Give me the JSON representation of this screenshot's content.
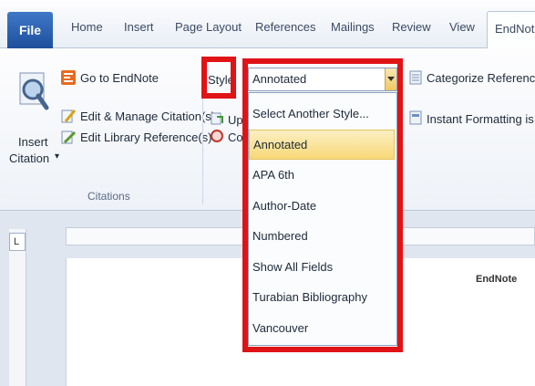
{
  "tabs": {
    "file": "File",
    "home": "Home",
    "insert": "Insert",
    "page_layout": "Page Layout",
    "references": "References",
    "mailings": "Mailings",
    "review": "Review",
    "view": "View",
    "endnote": "EndNote"
  },
  "citations_group": {
    "insert_citation_line1": "Insert",
    "insert_citation_line2": "Citation",
    "insert_citation_arrow": "▾",
    "go_to_endnote": "Go to EndNote",
    "edit_manage": "Edit & Manage Citation(s)",
    "edit_library": "Edit Library Reference(s)",
    "group_label": "Citations"
  },
  "bibliography_group": {
    "style_label": "Style",
    "update_partial": "Upd",
    "convert_partial": "Cor",
    "style_selected": "Annotated",
    "categorize": "Categorize References",
    "instant_formatting": "Instant Formatting is On"
  },
  "style_dropdown": {
    "items": [
      "Select Another Style...",
      "Annotated",
      "APA 6th",
      "Author-Date",
      "Numbered",
      "Show All Fields",
      "Turabian Bibliography",
      "Vancouver"
    ],
    "selected_index": 1
  },
  "document": {
    "endnote_label": "EndNote"
  },
  "colors": {
    "highlight": "#e01317",
    "file_tab": "#2a5fae",
    "selected_item": "#f7d978"
  }
}
